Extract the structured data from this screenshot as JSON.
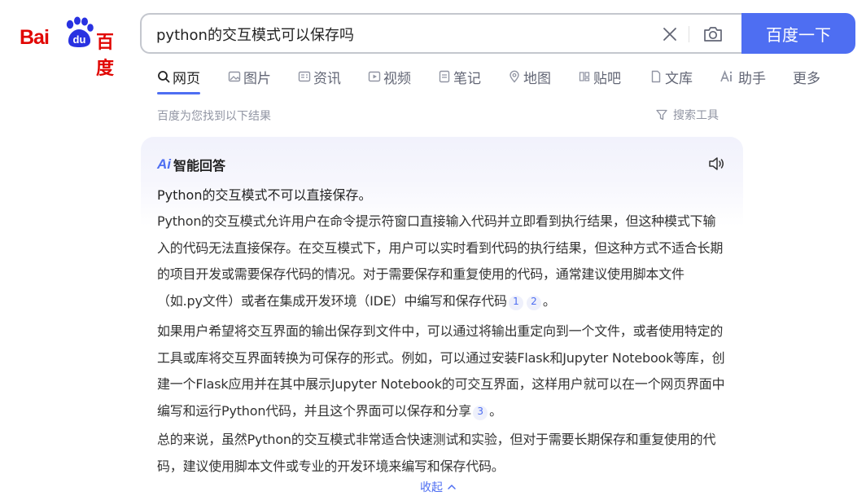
{
  "logo": {
    "left_text": "Bai",
    "paw_text": "du",
    "right_text": "百度"
  },
  "search": {
    "query": "python的交互模式可以保存吗",
    "button_label": "百度一下",
    "clear_icon": "close-icon",
    "camera_icon": "camera-icon"
  },
  "tabs": [
    {
      "label": "网页",
      "icon": "search-icon",
      "active": true
    },
    {
      "label": "图片",
      "icon": "image-icon"
    },
    {
      "label": "资讯",
      "icon": "news-icon"
    },
    {
      "label": "视频",
      "icon": "video-icon"
    },
    {
      "label": "笔记",
      "icon": "note-icon"
    },
    {
      "label": "地图",
      "icon": "map-pin-icon"
    },
    {
      "label": "贴吧",
      "icon": "tieba-icon"
    },
    {
      "label": "文库",
      "icon": "document-icon"
    },
    {
      "label": "助手",
      "icon": "ai-icon"
    },
    {
      "label": "更多"
    }
  ],
  "result_info": "百度为您找到以下结果",
  "tools_label": "搜索工具",
  "ai_answer": {
    "logo": "Ai",
    "title": "智能回答",
    "summary": "Python的交互模式不可以直接保存。",
    "p1": "Python的交互模式允许用户在命令提示符窗口直接输入代码并立即看到执行结果，但这种模式下输入的代码无法直接保存。在交互模式下，用户可以实时看到代码的执行结果，但这种方式不适合长期的项目开发或需要保存代码的情况。对于需要保存和重复使用的代码，通常建议使用脚本文件（如.py文件）或者在集成开发环境（IDE）中编写和保存代码",
    "p1_cites": [
      "1",
      "2"
    ],
    "p1_end": "。",
    "p2": "如果用户希望将交互界面的输出保存到文件中，可以通过将输出重定向到一个文件，或者使用特定的工具或库将交互界面转换为可保存的形式。例如，可以通过安装Flask和Jupyter Notebook等库，创建一个Flask应用并在其中展示Jupyter Notebook的可交互界面，这样用户就可以在一个网页界面中编写和运行Python代码，并且这个界面可以保存和分享",
    "p2_cites": [
      "3"
    ],
    "p2_end": "。",
    "p3": "总的来说，虽然Python的交互模式非常适合快速测试和实验，但对于需要长期保存和重复使用的代码，建议使用脚本文件或专业的开发环境来编写和保存代码。",
    "collapse_label": "收起"
  },
  "colors": {
    "brand_red": "#e10602",
    "brand_blue": "#4e6ef2",
    "muted": "#9195a3"
  }
}
